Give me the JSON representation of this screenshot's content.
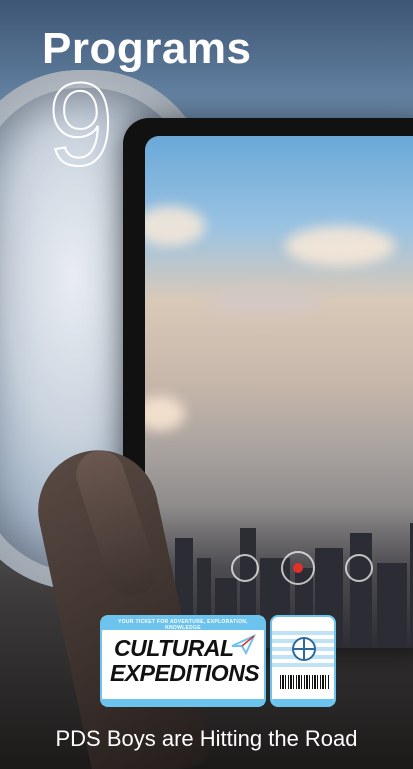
{
  "header": {
    "title": "Programs",
    "number": "9"
  },
  "ticket": {
    "tagline": "YOUR TICKET FOR ADVENTURE, EXPLORATION, KNOWLEDGE",
    "brand_line1": "CULTURAL",
    "brand_line2": "EXPEDITIONS"
  },
  "caption": "PDS Boys are Hitting the Road",
  "colors": {
    "ticket_accent": "#6cc3ee",
    "record_dot": "#e0302a"
  }
}
